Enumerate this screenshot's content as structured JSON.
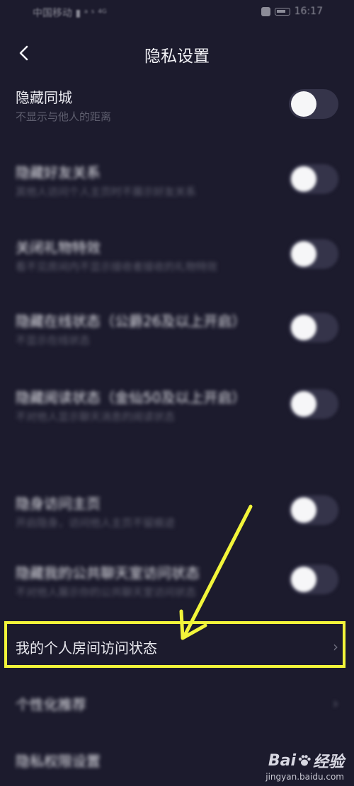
{
  "status_bar": {
    "carrier": "中国移动 ▮ ᵃ ˢ ⁴ᴳ",
    "time": "16:17"
  },
  "header": {
    "title": "隐私设置"
  },
  "settings": [
    {
      "title": "隐藏同城",
      "subtitle": "不显示与他人的距离"
    },
    {
      "title": "隐藏好友关系",
      "subtitle": "其他人访问个人主页时不展示好友关系"
    },
    {
      "title": "关闭礼物特效",
      "subtitle": "看不见房间内不显示接收者接收的礼物特效"
    },
    {
      "title": "隐藏在线状态（公爵26及以上开启）",
      "subtitle": "不显示在线状态"
    },
    {
      "title": "隐藏阅读状态（金仙50及以上开启）",
      "subtitle": "不对他人显示聊天消息的阅读状态"
    },
    {
      "title": "隐身访问主页",
      "subtitle": "开启隐身，访问他人主页不留痕迹"
    },
    {
      "title": "隐藏我的公共聊天室访问状态",
      "subtitle": "不对他人展示你的公共聊天室访问状态"
    }
  ],
  "nav_items": [
    {
      "label": "我的个人房间访问状态"
    },
    {
      "label": "个性化推荐"
    },
    {
      "label": "隐私权限设置"
    }
  ],
  "watermark": {
    "brand": "Bai",
    "brand_suffix": "经验",
    "url": "jingyan.baidu.com"
  },
  "colors": {
    "background": "#1c1b2d",
    "highlight": "#f2f53a",
    "toggle_track": "#35344a",
    "toggle_knob": "#f6f6f8"
  }
}
